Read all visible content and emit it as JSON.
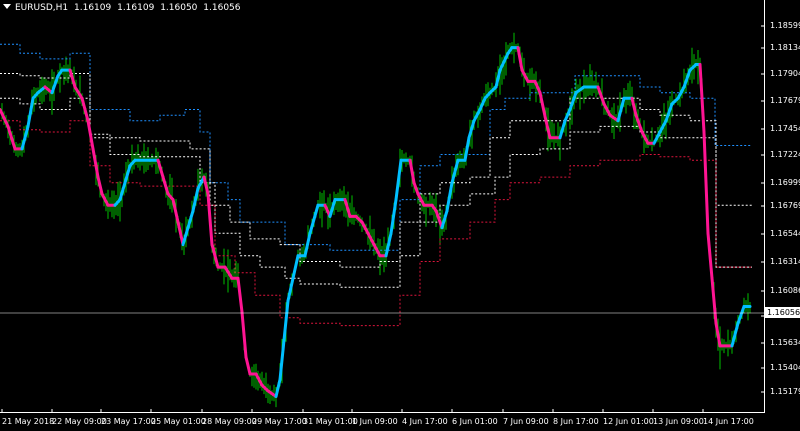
{
  "header": {
    "symbol": "EURUSD,H1",
    "open": "1.16109",
    "high": "1.16109",
    "low": "1.16050",
    "close": "1.16056",
    "menu_icon": "dropdown-triangle-icon"
  },
  "current_price": "1.16056",
  "colors": {
    "background": "#000000",
    "bars": "#00c000",
    "trend_up": "#00bfff",
    "trend_down": "#ff1493",
    "band_outer_up": "#1e90ff",
    "band_outer_down": "#dc143c",
    "band_mid": "#ffffff",
    "price_line": "#ffffff"
  },
  "y_axis": {
    "ticks": [
      "1.18599",
      "1.18134",
      "1.17904",
      "1.17679",
      "1.17454",
      "1.17224",
      "1.16999",
      "1.16769",
      "1.16544",
      "1.16314",
      "1.16086",
      "1.15864",
      "1.15634",
      "1.15404",
      "1.15179"
    ]
  },
  "x_axis": {
    "ticks": [
      "21 May 2018",
      "22 May 09:00",
      "23 May 17:00",
      "25 May 01:00",
      "28 May 09:00",
      "29 May 17:00",
      "31 May 01:00",
      "1 Jun 09:00",
      "4 Jun 17:00",
      "6 Jun 01:00",
      "7 Jun 09:00",
      "8 Jun 17:00",
      "12 Jun 01:00",
      "13 Jun 09:00",
      "14 Jun 17:00"
    ]
  },
  "chart_data": {
    "type": "line",
    "symbol": "EURUSD",
    "timeframe": "H1",
    "ylim": [
      1.1513,
      1.1872
    ],
    "series": [
      {
        "role": "trend-line",
        "points": [
          [
            0,
            1.178
          ],
          [
            8,
            1.1765
          ],
          [
            15,
            1.1745
          ],
          [
            22,
            1.1745
          ],
          [
            28,
            1.1765
          ],
          [
            33,
            1.179
          ],
          [
            38,
            1.1795
          ],
          [
            45,
            1.18
          ],
          [
            52,
            1.1795
          ],
          [
            58,
            1.181
          ],
          [
            62,
            1.1815
          ],
          [
            70,
            1.1815
          ],
          [
            75,
            1.18
          ],
          [
            82,
            1.179
          ],
          [
            88,
            1.177
          ],
          [
            93,
            1.1745
          ],
          [
            98,
            1.172
          ],
          [
            102,
            1.1705
          ],
          [
            108,
            1.1695
          ],
          [
            115,
            1.1695
          ],
          [
            120,
            1.17
          ],
          [
            125,
            1.1715
          ],
          [
            130,
            1.173
          ],
          [
            135,
            1.1735
          ],
          [
            150,
            1.1735
          ],
          [
            158,
            1.1735
          ],
          [
            163,
            1.172
          ],
          [
            168,
            1.1705
          ],
          [
            173,
            1.17
          ],
          [
            178,
            1.168
          ],
          [
            183,
            1.166
          ],
          [
            188,
            1.1675
          ],
          [
            193,
            1.169
          ],
          [
            198,
            1.171
          ],
          [
            204,
            1.172
          ],
          [
            208,
            1.1705
          ],
          [
            212,
            1.166
          ],
          [
            218,
            1.164
          ],
          [
            225,
            1.164
          ],
          [
            232,
            1.163
          ],
          [
            238,
            1.163
          ],
          [
            242,
            1.16
          ],
          [
            246,
            1.156
          ],
          [
            250,
            1.1545
          ],
          [
            256,
            1.1545
          ],
          [
            262,
            1.1535
          ],
          [
            268,
            1.153
          ],
          [
            276,
            1.1525
          ],
          [
            280,
            1.154
          ],
          [
            284,
            1.1575
          ],
          [
            288,
            1.161
          ],
          [
            293,
            1.163
          ],
          [
            298,
            1.165
          ],
          [
            305,
            1.165
          ],
          [
            310,
            1.167
          ],
          [
            318,
            1.1695
          ],
          [
            325,
            1.1695
          ],
          [
            330,
            1.1685
          ],
          [
            335,
            1.17
          ],
          [
            345,
            1.17
          ],
          [
            350,
            1.1685
          ],
          [
            356,
            1.1685
          ],
          [
            362,
            1.168
          ],
          [
            368,
            1.167
          ],
          [
            374,
            1.166
          ],
          [
            380,
            1.165
          ],
          [
            386,
            1.165
          ],
          [
            391,
            1.167
          ],
          [
            396,
            1.17
          ],
          [
            401,
            1.1735
          ],
          [
            410,
            1.1735
          ],
          [
            414,
            1.1715
          ],
          [
            418,
            1.1705
          ],
          [
            424,
            1.1695
          ],
          [
            432,
            1.1695
          ],
          [
            436,
            1.169
          ],
          [
            442,
            1.1675
          ],
          [
            447,
            1.169
          ],
          [
            452,
            1.1715
          ],
          [
            458,
            1.1735
          ],
          [
            465,
            1.1735
          ],
          [
            469,
            1.1755
          ],
          [
            474,
            1.177
          ],
          [
            480,
            1.178
          ],
          [
            485,
            1.179
          ],
          [
            490,
            1.1795
          ],
          [
            496,
            1.18
          ],
          [
            500,
            1.1815
          ],
          [
            508,
            1.183
          ],
          [
            512,
            1.1835
          ],
          [
            518,
            1.1835
          ],
          [
            522,
            1.1815
          ],
          [
            528,
            1.1805
          ],
          [
            535,
            1.1805
          ],
          [
            540,
            1.1795
          ],
          [
            546,
            1.177
          ],
          [
            550,
            1.1755
          ],
          [
            560,
            1.1755
          ],
          [
            565,
            1.177
          ],
          [
            570,
            1.178
          ],
          [
            576,
            1.1795
          ],
          [
            584,
            1.18
          ],
          [
            598,
            1.18
          ],
          [
            604,
            1.1785
          ],
          [
            610,
            1.1775
          ],
          [
            618,
            1.177
          ],
          [
            624,
            1.179
          ],
          [
            632,
            1.179
          ],
          [
            636,
            1.1775
          ],
          [
            642,
            1.176
          ],
          [
            648,
            1.175
          ],
          [
            654,
            1.175
          ],
          [
            660,
            1.176
          ],
          [
            666,
            1.177
          ],
          [
            672,
            1.1785
          ],
          [
            678,
            1.179
          ],
          [
            684,
            1.18
          ],
          [
            690,
            1.1815
          ],
          [
            696,
            1.182
          ],
          [
            700,
            1.182
          ],
          [
            704,
            1.176
          ],
          [
            708,
            1.167
          ],
          [
            712,
            1.163
          ],
          [
            716,
            1.159
          ],
          [
            720,
            1.157
          ],
          [
            732,
            1.157
          ],
          [
            738,
            1.159
          ],
          [
            744,
            1.1605
          ],
          [
            750,
            1.1605
          ]
        ]
      },
      {
        "role": "upper-band-outer",
        "points": [
          [
            0,
            1.1838
          ],
          [
            6,
            1.1838
          ],
          [
            20,
            1.183
          ],
          [
            40,
            1.1825
          ],
          [
            70,
            1.183
          ],
          [
            90,
            1.178
          ],
          [
            110,
            1.178
          ],
          [
            130,
            1.177
          ],
          [
            160,
            1.1775
          ],
          [
            185,
            1.178
          ],
          [
            200,
            1.176
          ],
          [
            210,
            1.1715
          ],
          [
            228,
            1.17
          ],
          [
            240,
            1.168
          ],
          [
            270,
            1.168
          ],
          [
            285,
            1.166
          ],
          [
            330,
            1.1655
          ],
          [
            380,
            1.1655
          ],
          [
            400,
            1.17
          ],
          [
            420,
            1.173
          ],
          [
            440,
            1.174
          ],
          [
            470,
            1.174
          ],
          [
            490,
            1.178
          ],
          [
            505,
            1.179
          ],
          [
            530,
            1.1795
          ],
          [
            560,
            1.1795
          ],
          [
            575,
            1.181
          ],
          [
            600,
            1.181
          ],
          [
            640,
            1.18
          ],
          [
            660,
            1.1795
          ],
          [
            690,
            1.179
          ],
          [
            700,
            1.179
          ],
          [
            715,
            1.1748
          ],
          [
            752,
            1.1748
          ]
        ]
      },
      {
        "role": "upper-band-inner",
        "points": [
          [
            0,
            1.1812
          ],
          [
            20,
            1.181
          ],
          [
            40,
            1.1808
          ],
          [
            70,
            1.1812
          ],
          [
            90,
            1.1758
          ],
          [
            110,
            1.1755
          ],
          [
            140,
            1.1752
          ],
          [
            170,
            1.1752
          ],
          [
            190,
            1.1745
          ],
          [
            210,
            1.1695
          ],
          [
            230,
            1.168
          ],
          [
            250,
            1.1665
          ],
          [
            280,
            1.166
          ],
          [
            300,
            1.1645
          ],
          [
            340,
            1.164
          ],
          [
            380,
            1.1645
          ],
          [
            400,
            1.168
          ],
          [
            420,
            1.1705
          ],
          [
            440,
            1.1715
          ],
          [
            470,
            1.172
          ],
          [
            490,
            1.1755
          ],
          [
            510,
            1.177
          ],
          [
            540,
            1.177
          ],
          [
            570,
            1.179
          ],
          [
            600,
            1.179
          ],
          [
            640,
            1.178
          ],
          [
            660,
            1.1775
          ],
          [
            690,
            1.177
          ],
          [
            700,
            1.177
          ],
          [
            716,
            1.1695
          ],
          [
            752,
            1.1695
          ]
        ]
      },
      {
        "role": "lower-band-inner",
        "points": [
          [
            0,
            1.179
          ],
          [
            20,
            1.1785
          ],
          [
            40,
            1.178
          ],
          [
            70,
            1.179
          ],
          [
            90,
            1.1755
          ],
          [
            110,
            1.174
          ],
          [
            140,
            1.1738
          ],
          [
            170,
            1.1738
          ],
          [
            200,
            1.1715
          ],
          [
            215,
            1.167
          ],
          [
            240,
            1.165
          ],
          [
            260,
            1.164
          ],
          [
            285,
            1.163
          ],
          [
            300,
            1.1625
          ],
          [
            340,
            1.1622
          ],
          [
            380,
            1.1622
          ],
          [
            400,
            1.165
          ],
          [
            420,
            1.168
          ],
          [
            440,
            1.1695
          ],
          [
            470,
            1.1705
          ],
          [
            495,
            1.172
          ],
          [
            510,
            1.174
          ],
          [
            540,
            1.1745
          ],
          [
            570,
            1.176
          ],
          [
            600,
            1.1765
          ],
          [
            640,
            1.176
          ],
          [
            660,
            1.1755
          ],
          [
            690,
            1.1755
          ],
          [
            700,
            1.1755
          ],
          [
            716,
            1.164
          ],
          [
            752,
            1.164
          ]
        ]
      },
      {
        "role": "lower-band-outer",
        "points": [
          [
            0,
            1.177
          ],
          [
            20,
            1.1762
          ],
          [
            40,
            1.176
          ],
          [
            70,
            1.177
          ],
          [
            90,
            1.173
          ],
          [
            110,
            1.1715
          ],
          [
            140,
            1.1712
          ],
          [
            170,
            1.1712
          ],
          [
            200,
            1.1695
          ],
          [
            215,
            1.165
          ],
          [
            235,
            1.1635
          ],
          [
            255,
            1.1615
          ],
          [
            280,
            1.1595
          ],
          [
            300,
            1.159
          ],
          [
            340,
            1.1588
          ],
          [
            390,
            1.1588
          ],
          [
            400,
            1.1615
          ],
          [
            420,
            1.1645
          ],
          [
            440,
            1.1665
          ],
          [
            470,
            1.168
          ],
          [
            495,
            1.17
          ],
          [
            510,
            1.1715
          ],
          [
            540,
            1.172
          ],
          [
            570,
            1.173
          ],
          [
            600,
            1.1735
          ],
          [
            640,
            1.174
          ],
          [
            660,
            1.1738
          ],
          [
            690,
            1.1735
          ],
          [
            700,
            1.1735
          ],
          [
            716,
            1.164
          ],
          [
            752,
            1.164
          ]
        ]
      }
    ]
  }
}
